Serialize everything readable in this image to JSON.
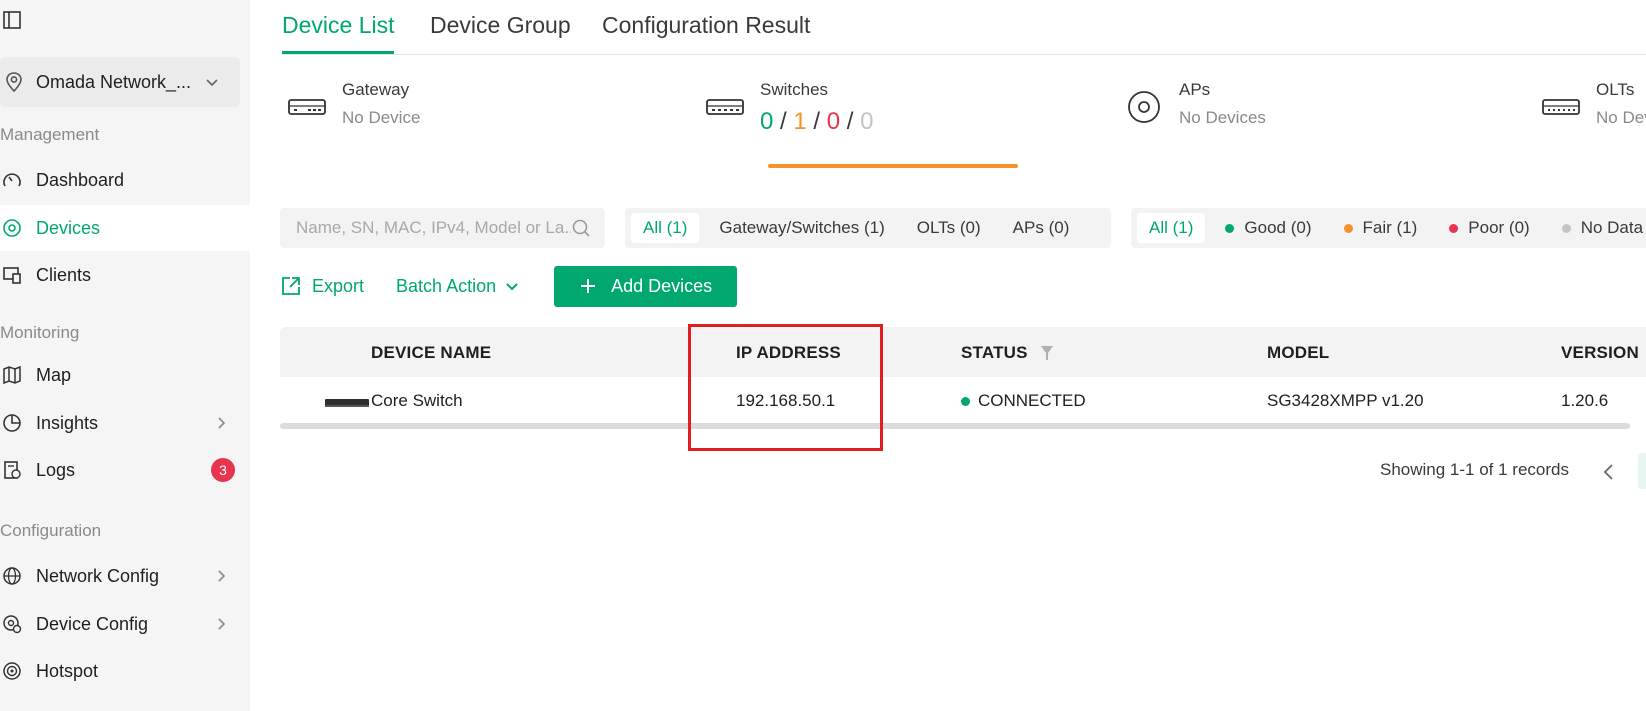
{
  "sidebar": {
    "site": "Omada Network_...",
    "sections": {
      "management": "Management",
      "monitoring": "Monitoring",
      "configuration": "Configuration"
    },
    "items": [
      {
        "label": "Dashboard",
        "icon": "dashboard-icon"
      },
      {
        "label": "Devices",
        "icon": "devices-icon",
        "active": true
      },
      {
        "label": "Clients",
        "icon": "clients-icon"
      },
      {
        "label": "Map",
        "icon": "map-icon"
      },
      {
        "label": "Insights",
        "icon": "insights-icon"
      },
      {
        "label": "Logs",
        "icon": "logs-icon",
        "badge": "3"
      },
      {
        "label": "Network Config",
        "icon": "globe-icon"
      },
      {
        "label": "Device Config",
        "icon": "device-config-icon"
      },
      {
        "label": "Hotspot",
        "icon": "hotspot-icon"
      }
    ]
  },
  "tabs": [
    "Device List",
    "Device Group",
    "Configuration Result"
  ],
  "summary": {
    "gateway": {
      "title": "Gateway",
      "sub": "No Device"
    },
    "switches": {
      "title": "Switches",
      "c1": "0",
      "c2": "1",
      "c3": "0",
      "c4": "0",
      "sep": "/"
    },
    "aps": {
      "title": "APs",
      "sub": "No Devices"
    },
    "olts": {
      "title": "OLTs",
      "sub": "No Devices"
    }
  },
  "search": {
    "placeholder": "Name, SN, MAC, IPv4, Model or La..."
  },
  "type_filters": [
    "All (1)",
    "Gateway/Switches (1)",
    "OLTs (0)",
    "APs (0)"
  ],
  "health_filters": [
    "All (1)",
    "Good (0)",
    "Fair (1)",
    "Poor (0)",
    "No Data"
  ],
  "actions": {
    "export": "Export",
    "batch": "Batch Action",
    "add": "Add Devices"
  },
  "table": {
    "headers": {
      "name": "DEVICE NAME",
      "ip": "IP ADDRESS",
      "status": "STATUS",
      "model": "MODEL",
      "version": "VERSION"
    },
    "rows": [
      {
        "name": "Core Switch",
        "ip": "192.168.50.1",
        "status": "CONNECTED",
        "model": "SG3428XMPP v1.20",
        "version": "1.20.6"
      }
    ]
  },
  "pager": {
    "text": "Showing 1-1 of 1 records"
  },
  "colors": {
    "accent": "#00a870",
    "fair": "#f5932a",
    "poor": "#e8344e",
    "highlight": "#e01e1e"
  }
}
